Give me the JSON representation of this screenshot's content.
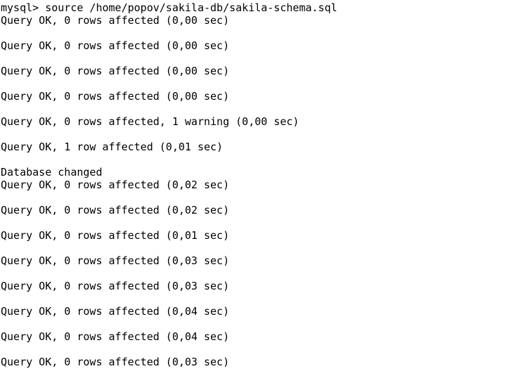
{
  "terminal": {
    "lines": [
      "mysql> source /home/popov/sakila-db/sakila-schema.sql",
      "Query OK, 0 rows affected (0,00 sec)",
      "",
      "Query OK, 0 rows affected (0,00 sec)",
      "",
      "Query OK, 0 rows affected (0,00 sec)",
      "",
      "Query OK, 0 rows affected (0,00 sec)",
      "",
      "Query OK, 0 rows affected, 1 warning (0,00 sec)",
      "",
      "Query OK, 1 row affected (0,01 sec)",
      "",
      "Database changed",
      "Query OK, 0 rows affected (0,02 sec)",
      "",
      "Query OK, 0 rows affected (0,02 sec)",
      "",
      "Query OK, 0 rows affected (0,01 sec)",
      "",
      "Query OK, 0 rows affected (0,03 sec)",
      "",
      "Query OK, 0 rows affected (0,03 sec)",
      "",
      "Query OK, 0 rows affected (0,04 sec)",
      "",
      "Query OK, 0 rows affected (0,04 sec)",
      "",
      "Query OK, 0 rows affected (0,03 sec)"
    ]
  }
}
